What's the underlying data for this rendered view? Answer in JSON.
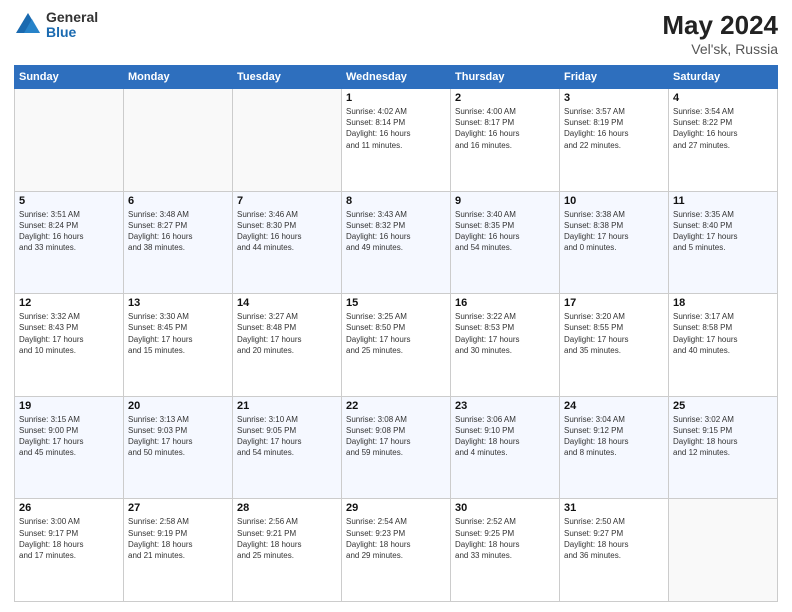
{
  "header": {
    "logo_general": "General",
    "logo_blue": "Blue",
    "month_year": "May 2024",
    "location": "Vel'sk, Russia"
  },
  "weekdays": [
    "Sunday",
    "Monday",
    "Tuesday",
    "Wednesday",
    "Thursday",
    "Friday",
    "Saturday"
  ],
  "weeks": [
    [
      {
        "day": "",
        "info": ""
      },
      {
        "day": "",
        "info": ""
      },
      {
        "day": "",
        "info": ""
      },
      {
        "day": "1",
        "info": "Sunrise: 4:02 AM\nSunset: 8:14 PM\nDaylight: 16 hours\nand 11 minutes."
      },
      {
        "day": "2",
        "info": "Sunrise: 4:00 AM\nSunset: 8:17 PM\nDaylight: 16 hours\nand 16 minutes."
      },
      {
        "day": "3",
        "info": "Sunrise: 3:57 AM\nSunset: 8:19 PM\nDaylight: 16 hours\nand 22 minutes."
      },
      {
        "day": "4",
        "info": "Sunrise: 3:54 AM\nSunset: 8:22 PM\nDaylight: 16 hours\nand 27 minutes."
      }
    ],
    [
      {
        "day": "5",
        "info": "Sunrise: 3:51 AM\nSunset: 8:24 PM\nDaylight: 16 hours\nand 33 minutes."
      },
      {
        "day": "6",
        "info": "Sunrise: 3:48 AM\nSunset: 8:27 PM\nDaylight: 16 hours\nand 38 minutes."
      },
      {
        "day": "7",
        "info": "Sunrise: 3:46 AM\nSunset: 8:30 PM\nDaylight: 16 hours\nand 44 minutes."
      },
      {
        "day": "8",
        "info": "Sunrise: 3:43 AM\nSunset: 8:32 PM\nDaylight: 16 hours\nand 49 minutes."
      },
      {
        "day": "9",
        "info": "Sunrise: 3:40 AM\nSunset: 8:35 PM\nDaylight: 16 hours\nand 54 minutes."
      },
      {
        "day": "10",
        "info": "Sunrise: 3:38 AM\nSunset: 8:38 PM\nDaylight: 17 hours\nand 0 minutes."
      },
      {
        "day": "11",
        "info": "Sunrise: 3:35 AM\nSunset: 8:40 PM\nDaylight: 17 hours\nand 5 minutes."
      }
    ],
    [
      {
        "day": "12",
        "info": "Sunrise: 3:32 AM\nSunset: 8:43 PM\nDaylight: 17 hours\nand 10 minutes."
      },
      {
        "day": "13",
        "info": "Sunrise: 3:30 AM\nSunset: 8:45 PM\nDaylight: 17 hours\nand 15 minutes."
      },
      {
        "day": "14",
        "info": "Sunrise: 3:27 AM\nSunset: 8:48 PM\nDaylight: 17 hours\nand 20 minutes."
      },
      {
        "day": "15",
        "info": "Sunrise: 3:25 AM\nSunset: 8:50 PM\nDaylight: 17 hours\nand 25 minutes."
      },
      {
        "day": "16",
        "info": "Sunrise: 3:22 AM\nSunset: 8:53 PM\nDaylight: 17 hours\nand 30 minutes."
      },
      {
        "day": "17",
        "info": "Sunrise: 3:20 AM\nSunset: 8:55 PM\nDaylight: 17 hours\nand 35 minutes."
      },
      {
        "day": "18",
        "info": "Sunrise: 3:17 AM\nSunset: 8:58 PM\nDaylight: 17 hours\nand 40 minutes."
      }
    ],
    [
      {
        "day": "19",
        "info": "Sunrise: 3:15 AM\nSunset: 9:00 PM\nDaylight: 17 hours\nand 45 minutes."
      },
      {
        "day": "20",
        "info": "Sunrise: 3:13 AM\nSunset: 9:03 PM\nDaylight: 17 hours\nand 50 minutes."
      },
      {
        "day": "21",
        "info": "Sunrise: 3:10 AM\nSunset: 9:05 PM\nDaylight: 17 hours\nand 54 minutes."
      },
      {
        "day": "22",
        "info": "Sunrise: 3:08 AM\nSunset: 9:08 PM\nDaylight: 17 hours\nand 59 minutes."
      },
      {
        "day": "23",
        "info": "Sunrise: 3:06 AM\nSunset: 9:10 PM\nDaylight: 18 hours\nand 4 minutes."
      },
      {
        "day": "24",
        "info": "Sunrise: 3:04 AM\nSunset: 9:12 PM\nDaylight: 18 hours\nand 8 minutes."
      },
      {
        "day": "25",
        "info": "Sunrise: 3:02 AM\nSunset: 9:15 PM\nDaylight: 18 hours\nand 12 minutes."
      }
    ],
    [
      {
        "day": "26",
        "info": "Sunrise: 3:00 AM\nSunset: 9:17 PM\nDaylight: 18 hours\nand 17 minutes."
      },
      {
        "day": "27",
        "info": "Sunrise: 2:58 AM\nSunset: 9:19 PM\nDaylight: 18 hours\nand 21 minutes."
      },
      {
        "day": "28",
        "info": "Sunrise: 2:56 AM\nSunset: 9:21 PM\nDaylight: 18 hours\nand 25 minutes."
      },
      {
        "day": "29",
        "info": "Sunrise: 2:54 AM\nSunset: 9:23 PM\nDaylight: 18 hours\nand 29 minutes."
      },
      {
        "day": "30",
        "info": "Sunrise: 2:52 AM\nSunset: 9:25 PM\nDaylight: 18 hours\nand 33 minutes."
      },
      {
        "day": "31",
        "info": "Sunrise: 2:50 AM\nSunset: 9:27 PM\nDaylight: 18 hours\nand 36 minutes."
      },
      {
        "day": "",
        "info": ""
      }
    ]
  ]
}
